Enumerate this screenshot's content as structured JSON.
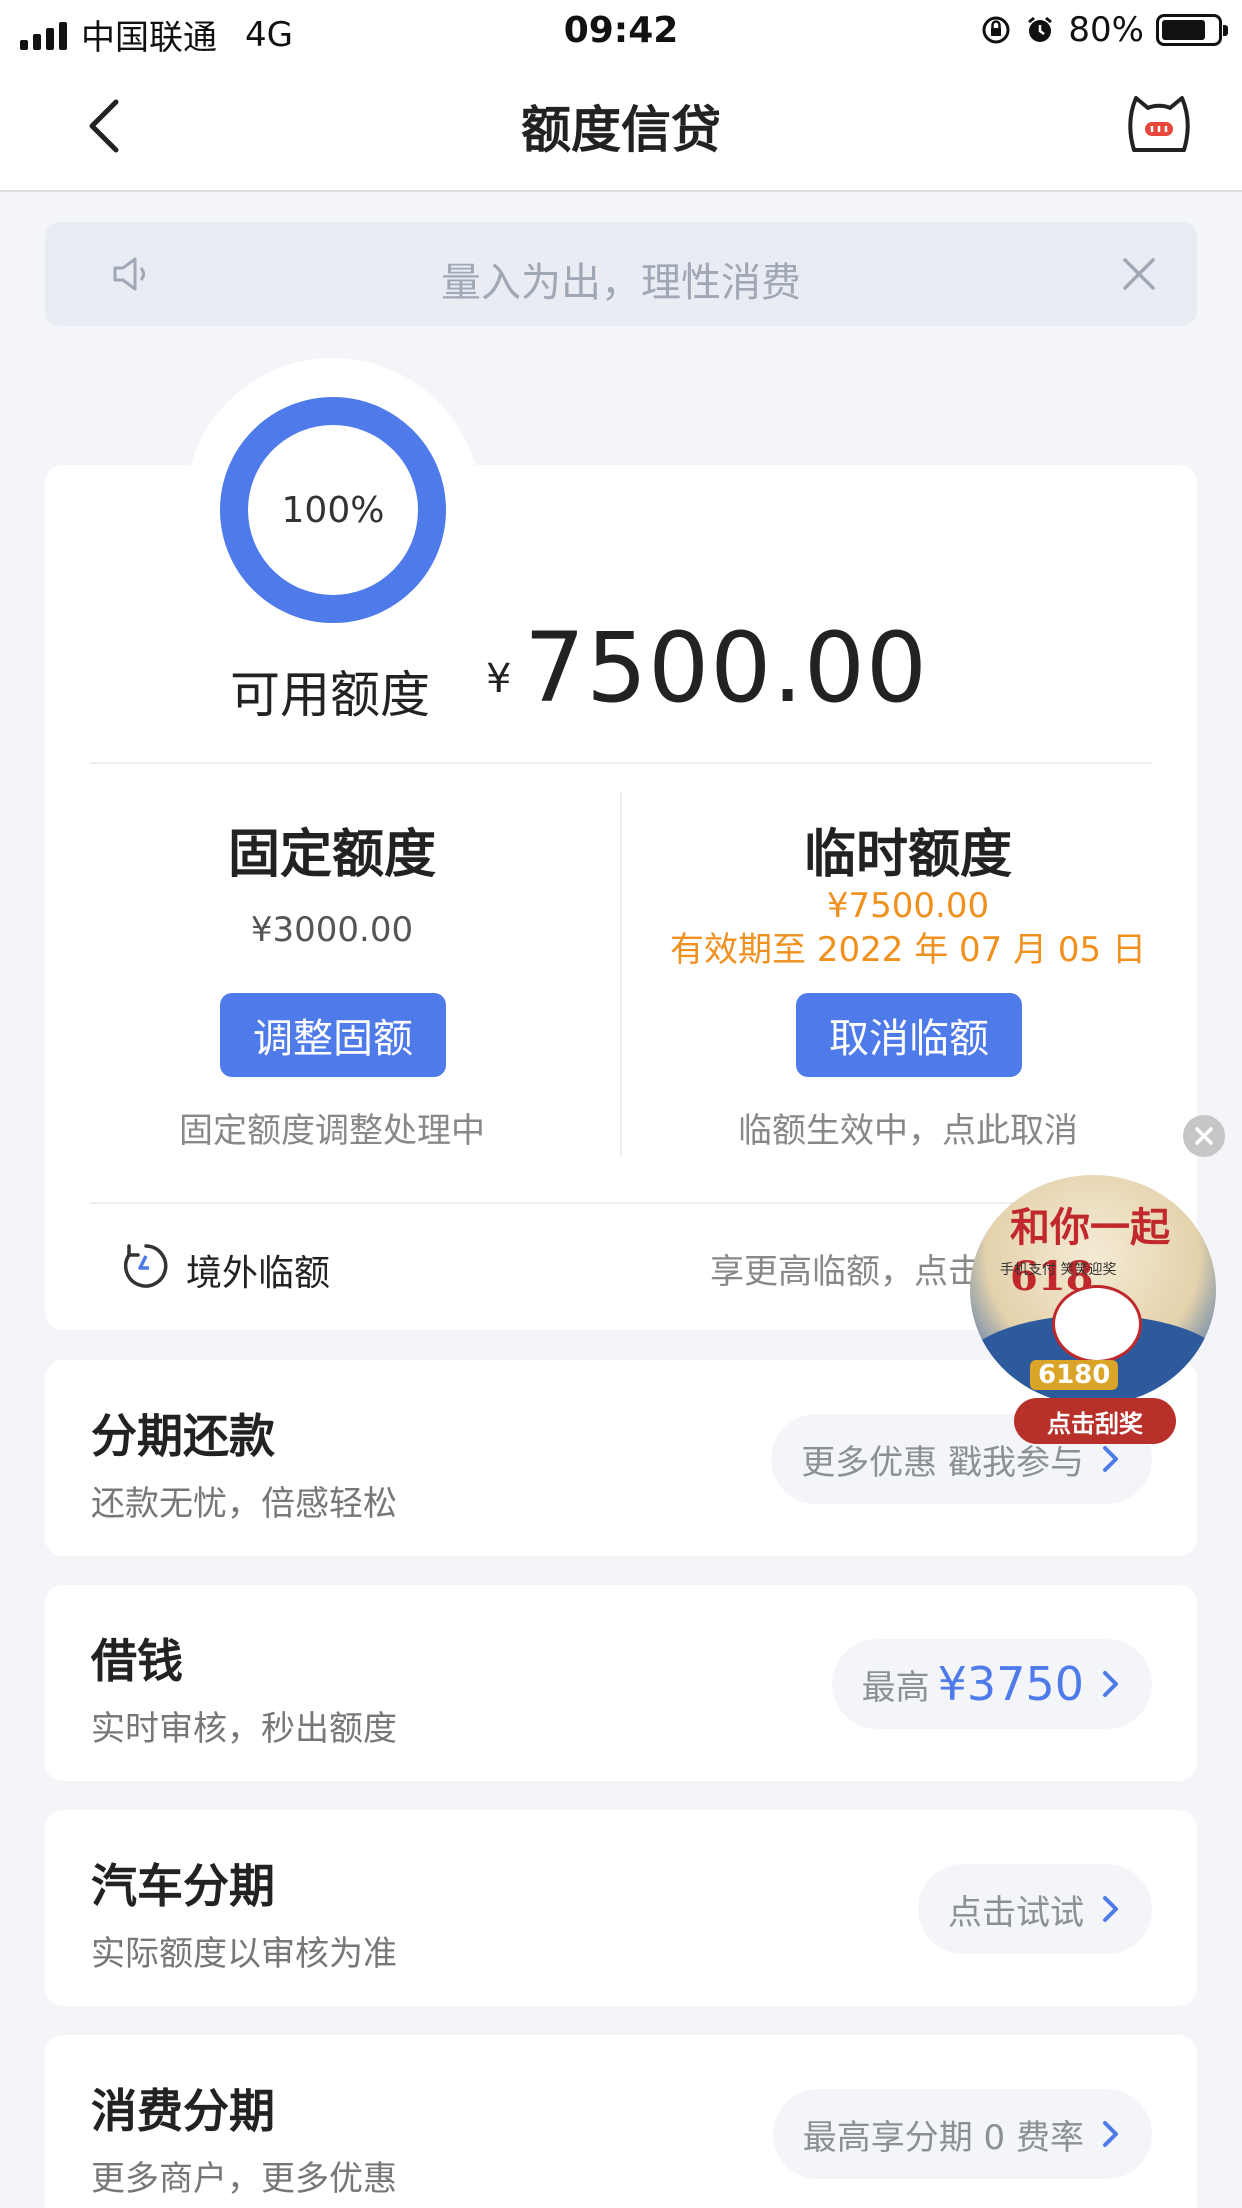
{
  "status_bar": {
    "carrier": "中国联通",
    "network": "4G",
    "time": "09:42",
    "battery": "80%"
  },
  "nav": {
    "title": "额度信贷"
  },
  "notice": {
    "text": "量入为出，理性消费"
  },
  "quota": {
    "usage_percent": "100%",
    "available_label": "可用额度",
    "currency": "¥",
    "available_amount": "7500.00",
    "fixed": {
      "title": "固定额度",
      "amount": "¥3000.00",
      "button": "调整固额",
      "status": "固定额度调整处理中"
    },
    "temporary": {
      "title": "临时额度",
      "amount": "¥7500.00",
      "validity": "有效期至 2022 年 07 月 05 日",
      "button": "取消临额",
      "status": "临额生效中，点此取消"
    },
    "overseas": {
      "label": "境外临额",
      "hint": "享更高临额，点击"
    }
  },
  "services": [
    {
      "title": "分期还款",
      "subtitle": "还款无忧，倍感轻松",
      "action": "更多优惠 戳我参与"
    },
    {
      "title": "借钱",
      "subtitle": "实时审核，秒出额度",
      "action_prefix": "最高",
      "action_amount": "¥3750"
    },
    {
      "title": "汽车分期",
      "subtitle": "实际额度以审核为准",
      "action": "点击试试"
    },
    {
      "title": "消费分期",
      "subtitle": "更多商户，更多优惠",
      "action": "最高享分期 0 费率"
    }
  ],
  "promo": {
    "headline": "和你一起618",
    "subline": "手机支付 笑笑迎奖",
    "tag": "6180",
    "button": "点击刮奖"
  },
  "colors": {
    "accent": "#4f7bea",
    "warning": "#f0901f",
    "background": "#f4f5f8"
  }
}
